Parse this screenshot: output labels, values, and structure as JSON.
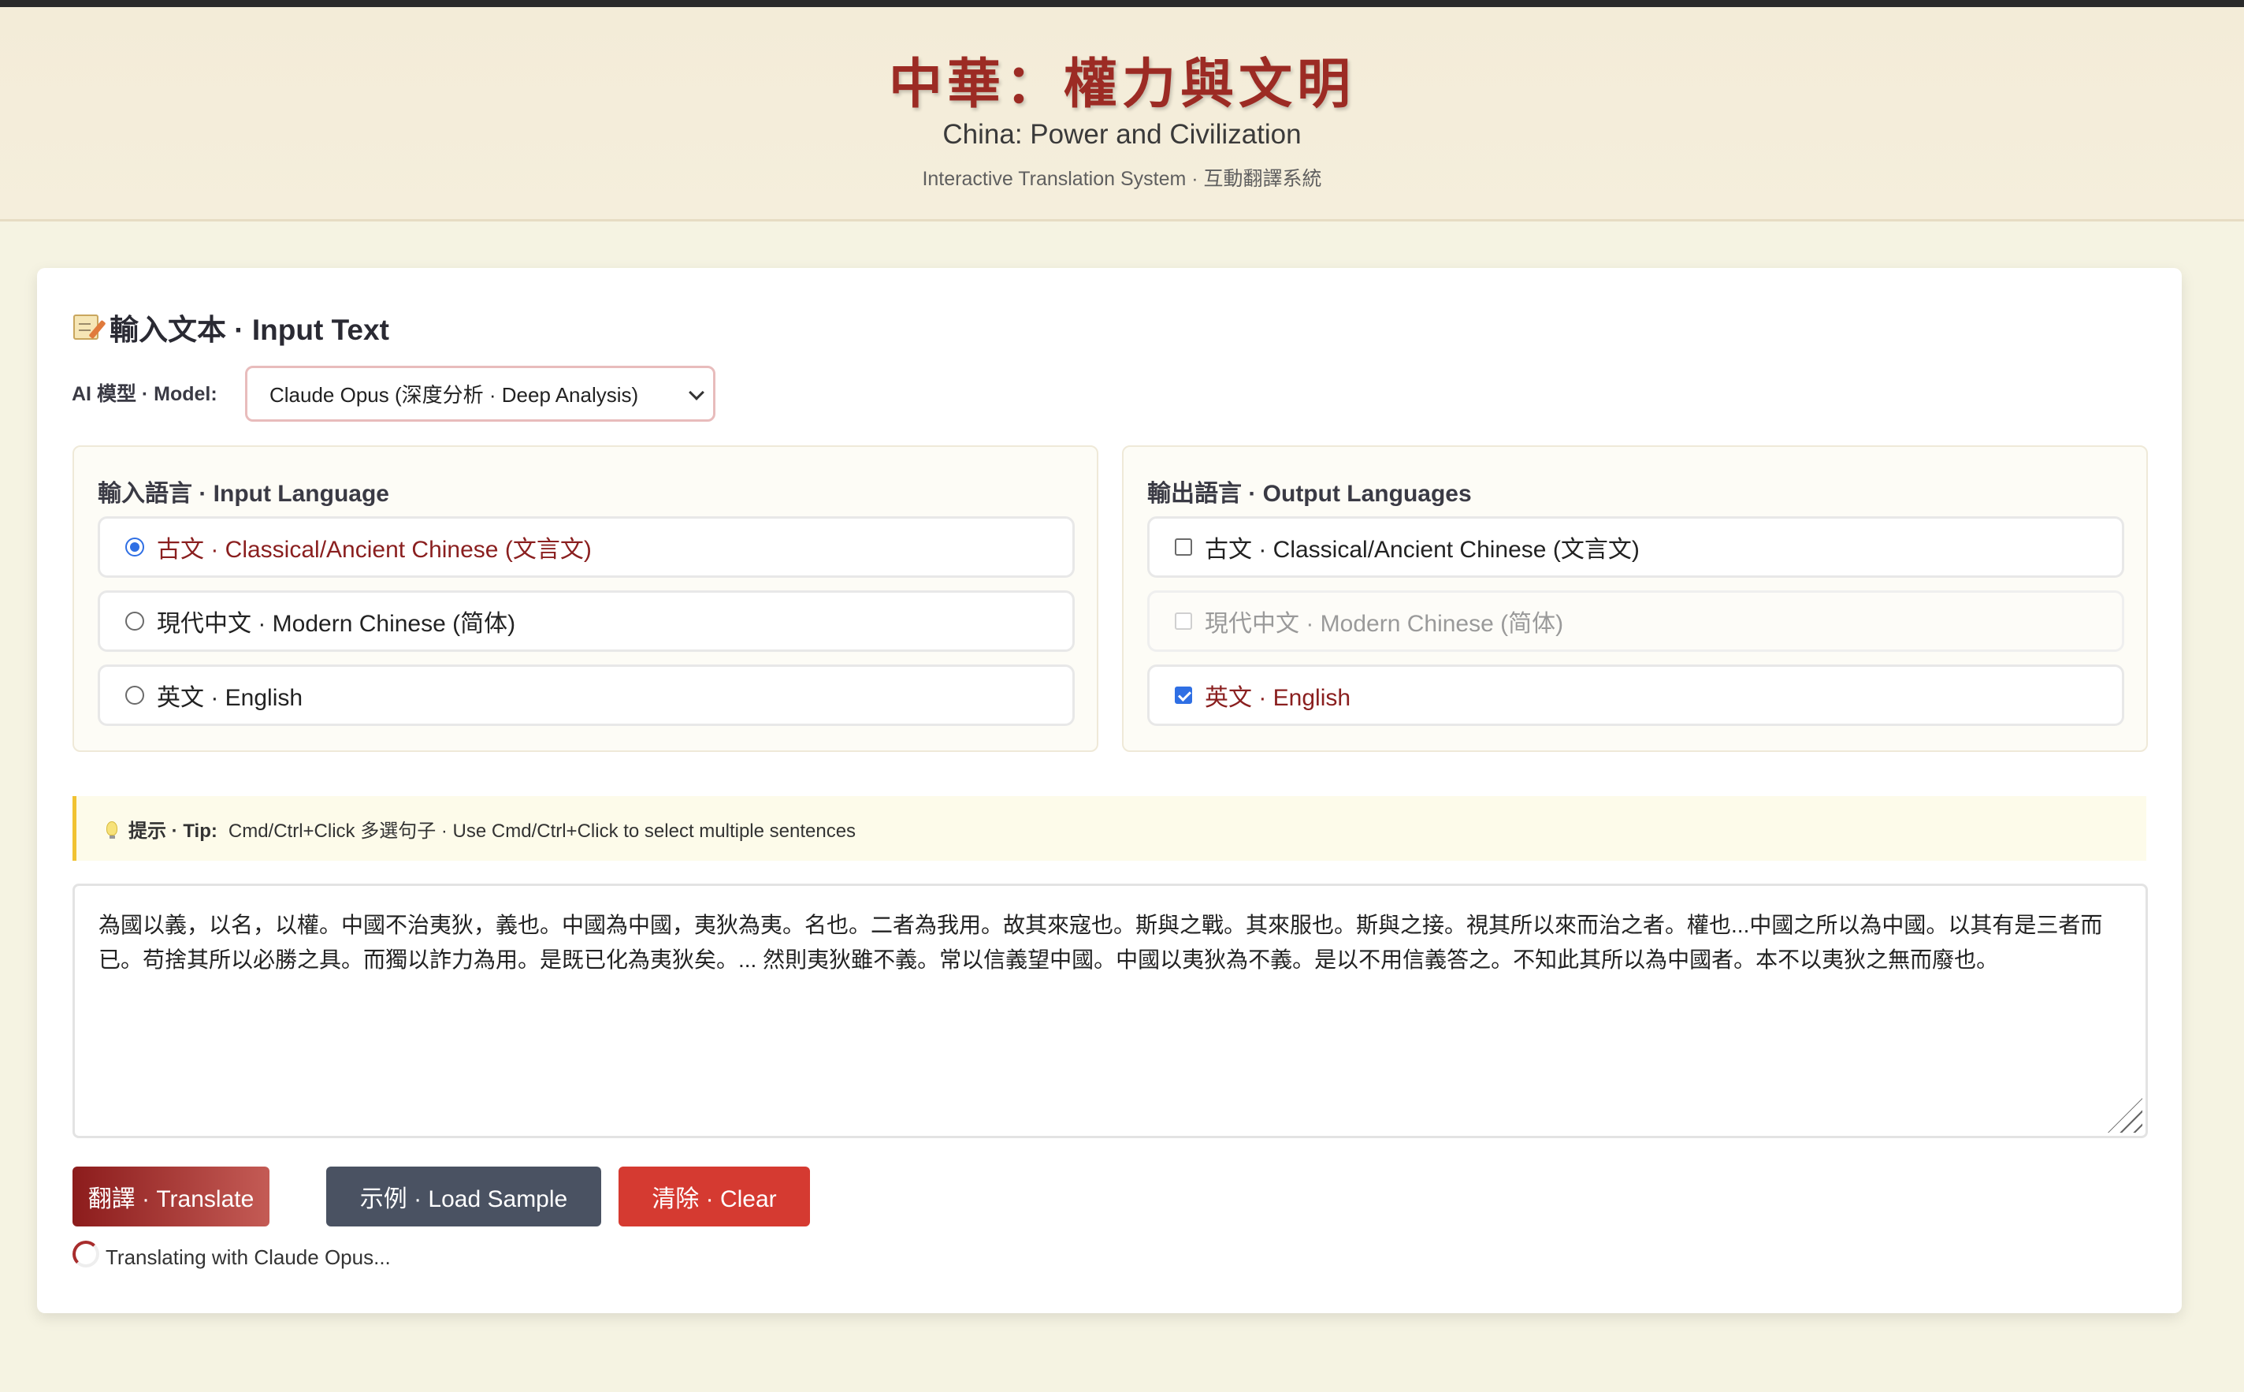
{
  "header": {
    "title_cn": "中華：權力與文明",
    "title_en": "China: Power and Civilization",
    "subtitle": "Interactive Translation System · 互動翻譯系統"
  },
  "input_section": {
    "title": "輸入文本 · Input Text",
    "icon": "memo-icon"
  },
  "model": {
    "label": "AI 模型 · Model:",
    "selected": "Claude Opus (深度分析 · Deep Analysis)"
  },
  "input_language": {
    "title": "輸入語言 · Input Language",
    "options": [
      {
        "label": "古文 · Classical/Ancient Chinese (文言文)",
        "selected": true
      },
      {
        "label": "現代中文 · Modern Chinese (简体)",
        "selected": false
      },
      {
        "label": "英文 · English",
        "selected": false
      }
    ]
  },
  "output_languages": {
    "title": "輸出語言 · Output Languages",
    "options": [
      {
        "label": "古文 · Classical/Ancient Chinese (文言文)",
        "checked": false,
        "disabled": false
      },
      {
        "label": "現代中文 · Modern Chinese (简体)",
        "checked": false,
        "disabled": true
      },
      {
        "label": "英文 · English",
        "checked": true,
        "disabled": false
      }
    ]
  },
  "tip": {
    "icon": "bulb-icon",
    "label": "提示 · Tip:",
    "text": "Cmd/Ctrl+Click 多選句子 · Use Cmd/Ctrl+Click to select multiple sentences"
  },
  "textarea": {
    "value": "為國以義，以名，以權。中國不治夷狄，義也。中國為中國，夷狄為夷。名也。二者為我用。故其來寇也。斯與之戰。其來服也。斯與之接。視其所以來而治之者。權也...中國之所以為中國。以其有是三者而已。苟捨其所以必勝之具。而獨以詐力為用。是既已化為夷狄矣。... 然則夷狄雖不義。常以信義望中國。中國以夷狄為不義。是以不用信義答之。不知此其所以為中國者。本不以夷狄之無而廢也。"
  },
  "buttons": {
    "translate": "翻譯 · Translate",
    "sample": "示例 · Load Sample",
    "clear": "清除 · Clear"
  },
  "status": {
    "text": "Translating with Claude Opus..."
  },
  "colors": {
    "accent": "#9c2b24",
    "checkbox": "#2f6fe4",
    "tip_border": "#f1c232",
    "clear_button": "#d53a31",
    "sample_button": "#4a5262"
  }
}
